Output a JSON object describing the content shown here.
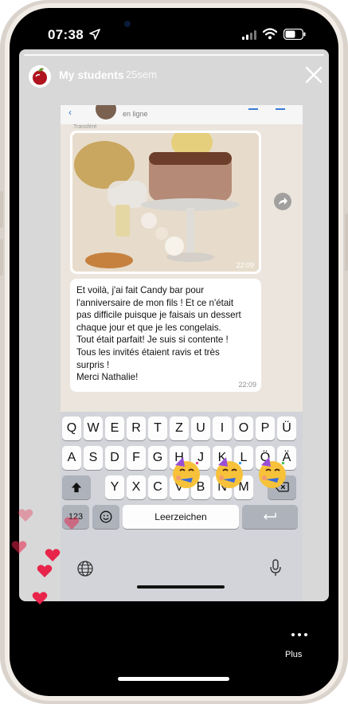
{
  "status_bar": {
    "time": "07:38"
  },
  "story": {
    "username": "My students",
    "age": "25sem",
    "close_icon": "close-icon"
  },
  "chat": {
    "contact_status": "en ligne",
    "forwarded_label": "Transféré",
    "image_time": "22:09",
    "message_lines": [
      "Et voilà, j'ai fait Candy bar pour",
      "l'anniversaire de mon fils !  Et ce n'était",
      "pas difficile puisque je faisais un dessert",
      "chaque jour et que je les congelais.",
      "Tout était parfait! Je suis si contente !",
      "Tous les invités étaient ravis et très",
      "surpris !",
      "Merci Nathalie!"
    ],
    "message_time": "22:09",
    "input_value": ""
  },
  "keyboard": {
    "row1": [
      "Q",
      "W",
      "E",
      "R",
      "T",
      "Z",
      "U",
      "I",
      "O",
      "P",
      "Ü"
    ],
    "row2": [
      "A",
      "S",
      "D",
      "F",
      "G",
      "H",
      "J",
      "K",
      "L",
      "Ö",
      "Ä"
    ],
    "row3": [
      "Y",
      "X",
      "C",
      "V",
      "B",
      "N",
      "M"
    ],
    "numbers_key": "123",
    "space_key": "Leerzeichen"
  },
  "bottom": {
    "more_label": "Plus"
  },
  "colors": {
    "story_bg": "#d8d8d8",
    "chat_bg": "#ece5dd",
    "accent_blue": "#2f7fe0",
    "heart": "#e8244a"
  }
}
